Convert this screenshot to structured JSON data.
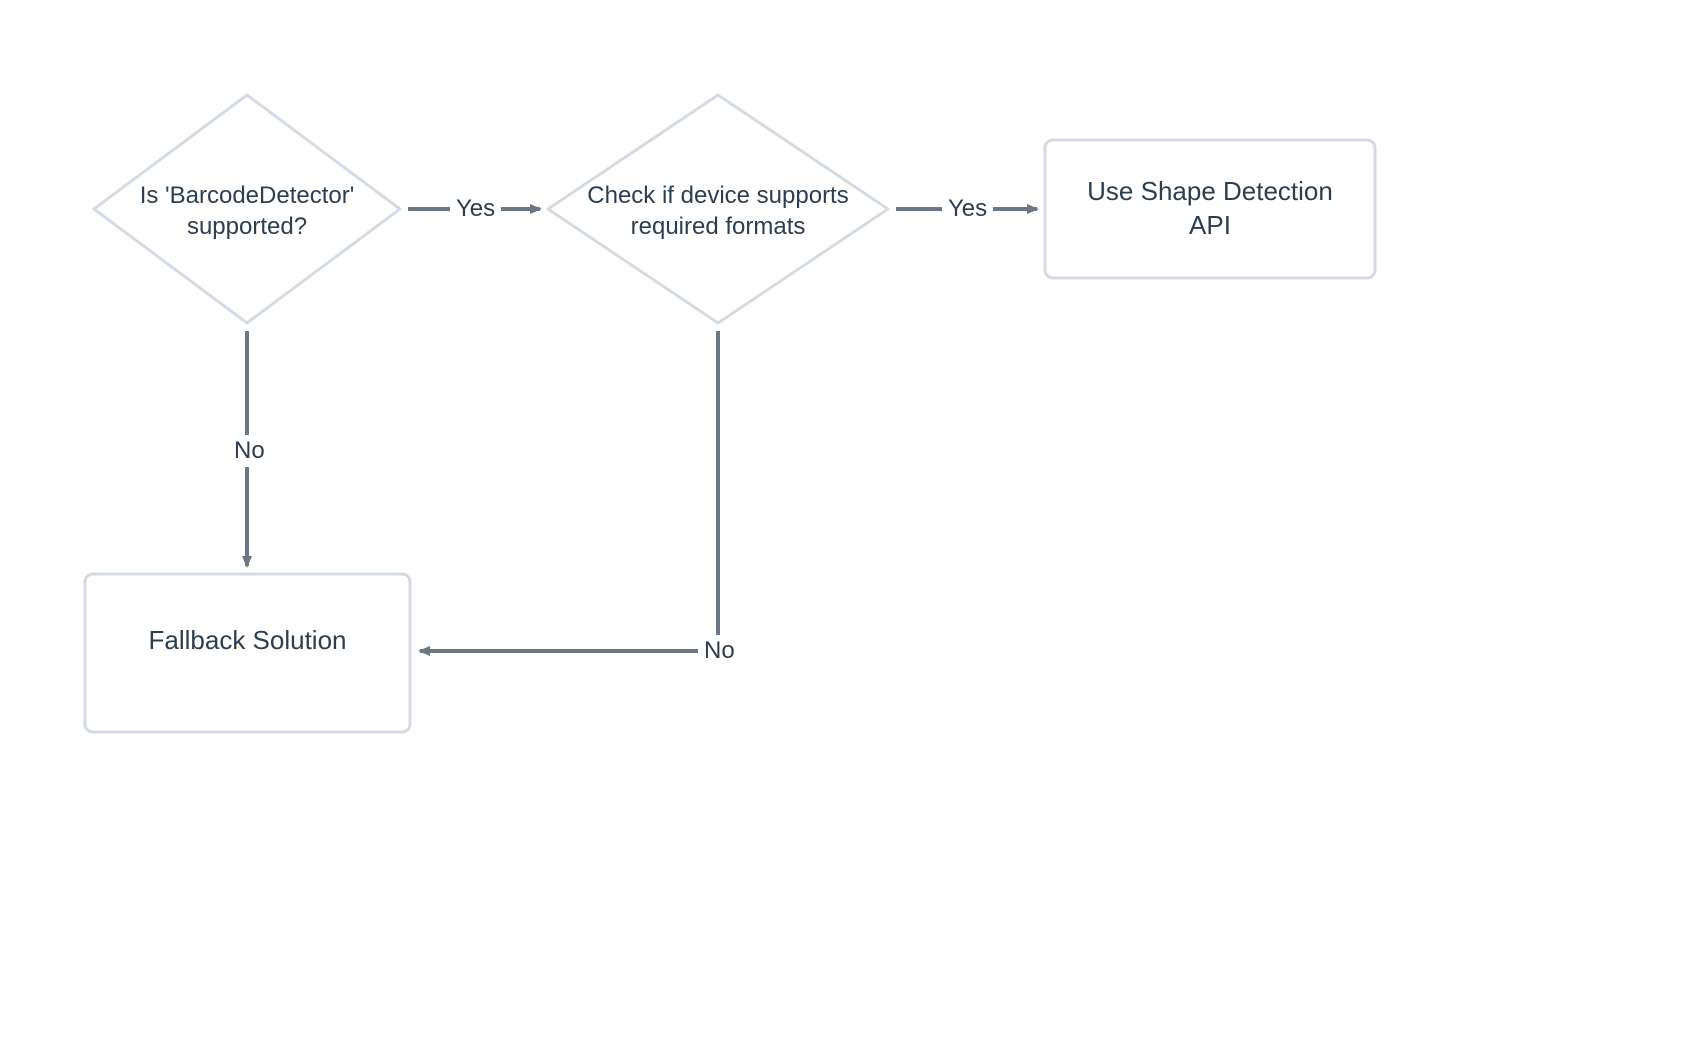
{
  "diagram": {
    "decision1": {
      "line1": "Is 'BarcodeDetector'",
      "line2": "supported?"
    },
    "decision2": {
      "line1": "Check if device supports",
      "line2": "required formats"
    },
    "terminal_api": {
      "line1": "Use Shape Detection",
      "line2": "API"
    },
    "terminal_fallback": "Fallback Solution",
    "labels": {
      "yes1": "Yes",
      "yes2": "Yes",
      "no1": "No",
      "no2": "No"
    },
    "colors": {
      "shape_stroke": "#d5dbe5",
      "arrow_stroke": "#6b7785",
      "text": "#2c3e50"
    }
  }
}
